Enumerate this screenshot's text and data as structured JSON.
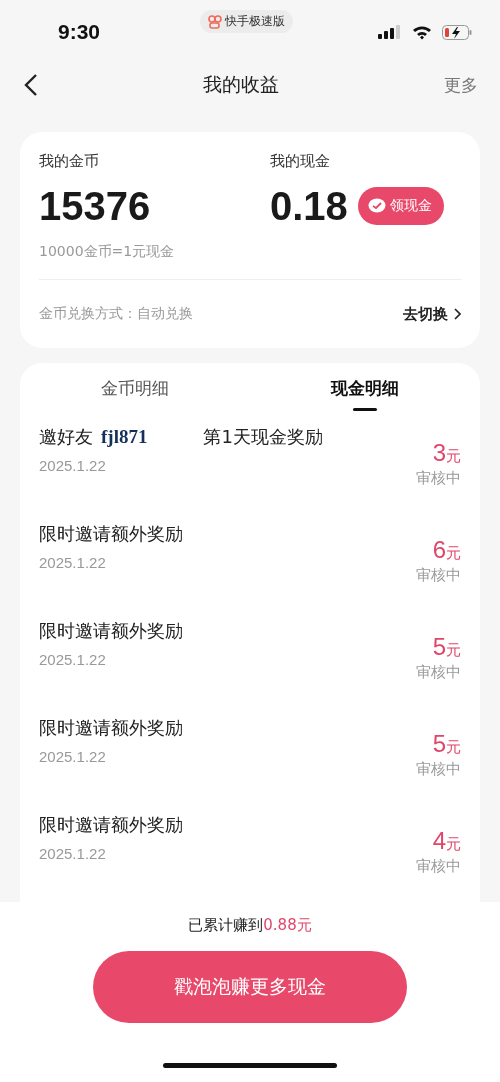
{
  "status_bar": {
    "time": "9:30",
    "app_pill": "快手极速版"
  },
  "nav": {
    "title": "我的收益",
    "action": "更多"
  },
  "summary": {
    "coins_label": "我的金币",
    "coins": "15376",
    "rate": "10000金币=1元现金",
    "cash_label": "我的现金",
    "cash": "0.18",
    "withdraw_button": "领现金",
    "exchange_label": "金币兑换方式：自动兑换",
    "switch_link": "去切换"
  },
  "tabs": [
    {
      "label": "金币明细",
      "selected": false
    },
    {
      "label": "现金明细",
      "selected": true
    }
  ],
  "records": [
    {
      "kind": "invite",
      "title": "邀好友",
      "friend": "fjl871",
      "detail": "第1天现金奖励",
      "date": "2025.1.22",
      "amount": "3",
      "unit": "元",
      "status": "审核中"
    },
    {
      "kind": "plain",
      "title": "限时邀请额外奖励",
      "date": "2025.1.22",
      "amount": "6",
      "unit": "元",
      "status": "审核中"
    },
    {
      "kind": "plain",
      "title": "限时邀请额外奖励",
      "date": "2025.1.22",
      "amount": "5",
      "unit": "元",
      "status": "审核中"
    },
    {
      "kind": "plain",
      "title": "限时邀请额外奖励",
      "date": "2025.1.22",
      "amount": "5",
      "unit": "元",
      "status": "审核中"
    },
    {
      "kind": "plain",
      "title": "限时邀请额外奖励",
      "date": "2025.1.22",
      "amount": "4",
      "unit": "元",
      "status": "审核中"
    }
  ],
  "footer": {
    "total_label": "已累计赚到",
    "total_value": "0.88元",
    "button": "戳泡泡赚更多现金"
  }
}
